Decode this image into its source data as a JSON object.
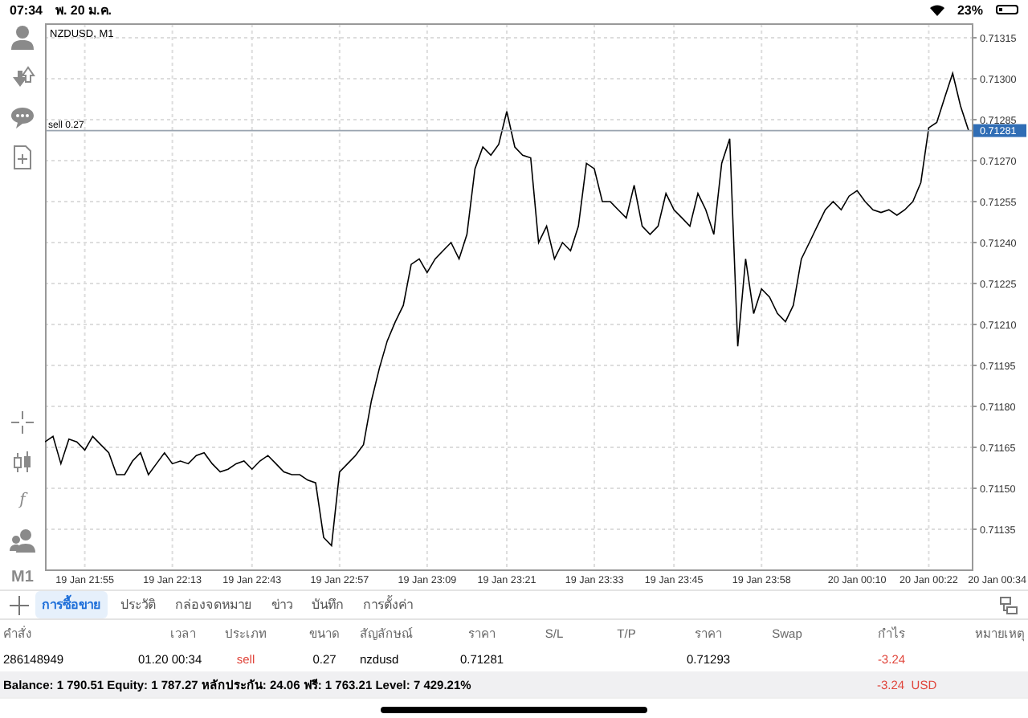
{
  "status_bar": {
    "time": "07:34",
    "date": "พ. 20 ม.ค.",
    "battery": "23%"
  },
  "toolbar": {
    "top": [
      {
        "kind": "person"
      },
      {
        "kind": "arrows"
      },
      {
        "kind": "chat"
      },
      {
        "kind": "new-doc"
      }
    ],
    "bottom": [
      {
        "kind": "crosshair"
      },
      {
        "kind": "candles"
      },
      {
        "kind": "text",
        "text": "f"
      },
      {
        "kind": "people"
      },
      {
        "kind": "text",
        "text": "M1"
      }
    ]
  },
  "chart": {
    "price_tag": "0.71281",
    "edge_time_label": "20 Jan 00:34",
    "chart_data": {
      "type": "line",
      "title": "NZDUSD, M1",
      "grid": true,
      "ylim": [
        0.7112,
        0.7132
      ],
      "yticks": [
        {
          "value": 0.71135,
          "label": "0.71135"
        },
        {
          "value": 0.7115,
          "label": "0.71150"
        },
        {
          "value": 0.71165,
          "label": "0.71165"
        },
        {
          "value": 0.7118,
          "label": "0.71180"
        },
        {
          "value": 0.71195,
          "label": "0.71195"
        },
        {
          "value": 0.7121,
          "label": "0.71210"
        },
        {
          "value": 0.71225,
          "label": "0.71225"
        },
        {
          "value": 0.7124,
          "label": "0.71240"
        },
        {
          "value": 0.71255,
          "label": "0.71255"
        },
        {
          "value": 0.7127,
          "label": "0.71270"
        },
        {
          "value": 0.71285,
          "label": "0.71285"
        },
        {
          "value": 0.713,
          "label": "0.71300"
        },
        {
          "value": 0.71315,
          "label": "0.71315"
        }
      ],
      "categories": [
        null,
        null,
        null,
        null,
        null,
        "19 Jan 21:55",
        null,
        null,
        null,
        null,
        null,
        null,
        null,
        null,
        null,
        null,
        "19 Jan 22:13",
        null,
        null,
        null,
        null,
        null,
        null,
        null,
        null,
        null,
        "19 Jan 22:43",
        null,
        null,
        null,
        null,
        null,
        null,
        null,
        null,
        null,
        null,
        "19 Jan 22:57",
        null,
        null,
        null,
        null,
        null,
        null,
        null,
        null,
        null,
        null,
        "19 Jan 23:09",
        null,
        null,
        null,
        null,
        null,
        null,
        null,
        null,
        null,
        "19 Jan 23:21",
        null,
        null,
        null,
        null,
        null,
        null,
        null,
        null,
        null,
        null,
        "19 Jan 23:33",
        null,
        null,
        null,
        null,
        null,
        null,
        null,
        null,
        null,
        "19 Jan 23:45",
        null,
        null,
        null,
        null,
        null,
        null,
        null,
        null,
        null,
        null,
        "19 Jan 23:58",
        null,
        null,
        null,
        null,
        null,
        null,
        null,
        null,
        null,
        null,
        null,
        "20 Jan 00:10",
        null,
        null,
        null,
        null,
        null,
        null,
        null,
        null,
        "20 Jan 00:22",
        null,
        null,
        null,
        null,
        null
      ],
      "values": [
        0.71167,
        0.71169,
        0.71159,
        0.71168,
        0.71167,
        0.71164,
        0.71169,
        0.71166,
        0.71163,
        0.71155,
        0.71155,
        0.7116,
        0.71163,
        0.71155,
        0.71159,
        0.71163,
        0.71159,
        0.7116,
        0.71159,
        0.71162,
        0.71163,
        0.71159,
        0.71156,
        0.71157,
        0.71159,
        0.7116,
        0.71157,
        0.7116,
        0.71162,
        0.71159,
        0.71156,
        0.71155,
        0.71155,
        0.71153,
        0.71152,
        0.71132,
        0.71129,
        0.71156,
        0.71159,
        0.71162,
        0.71166,
        0.71182,
        0.71194,
        0.71204,
        0.71211,
        0.71217,
        0.71232,
        0.71234,
        0.71229,
        0.71234,
        0.71237,
        0.7124,
        0.71234,
        0.71243,
        0.71267,
        0.71275,
        0.71272,
        0.71276,
        0.71288,
        0.71275,
        0.71272,
        0.71271,
        0.7124,
        0.71246,
        0.71234,
        0.7124,
        0.71237,
        0.71246,
        0.71269,
        0.71267,
        0.71255,
        0.71255,
        0.71252,
        0.71249,
        0.71261,
        0.71246,
        0.71243,
        0.71246,
        0.71258,
        0.71252,
        0.71249,
        0.71246,
        0.71258,
        0.71252,
        0.71243,
        0.71269,
        0.71278,
        0.71202,
        0.71234,
        0.71214,
        0.71223,
        0.7122,
        0.71214,
        0.71211,
        0.71217,
        0.71234,
        0.7124,
        0.71246,
        0.71252,
        0.71255,
        0.71252,
        0.71257,
        0.71259,
        0.71255,
        0.71252,
        0.71251,
        0.71252,
        0.7125,
        0.71252,
        0.71255,
        0.71262,
        0.71282,
        0.71284,
        0.71293,
        0.71302,
        0.7129,
        0.71281
      ],
      "ref_lines": [
        {
          "axis": "y",
          "value": 0.71281,
          "label": "sell 0.27",
          "color": "#9aa4b0"
        }
      ]
    }
  },
  "tabs": [
    {
      "label": "การซื้อขาย",
      "selected": true
    },
    {
      "label": "ประวัติ",
      "selected": false
    },
    {
      "label": "กล่องจดหมาย",
      "selected": false
    },
    {
      "label": "ข่าว",
      "selected": false
    },
    {
      "label": "บันทึก",
      "selected": false
    },
    {
      "label": "การตั้งค่า",
      "selected": false
    }
  ],
  "table": {
    "columns": [
      "คำสั่ง",
      "เวลา",
      "ประเภท",
      "ขนาด",
      "สัญลักษณ์",
      "ราคา",
      "S/L",
      "T/P",
      "ราคา",
      "Swap",
      "กำไร",
      "หมายเหตุ"
    ],
    "rows": [
      {
        "order": "286148949",
        "time": "01.20 00:34",
        "type": "sell",
        "volume": "0.27",
        "symbol": "nzdusd",
        "price": "0.71281",
        "current_price": "0.71293",
        "profit": "-3.24",
        "sell": true,
        "loss": true
      }
    ]
  },
  "summary": {
    "text": "Balance: 1 790.51 Equity: 1 787.27 หลักประกัน: 24.06 ฟรี: 1 763.21 Level: 7 429.21%",
    "profit": "-3.24",
    "currency": "USD",
    "negative": true
  }
}
